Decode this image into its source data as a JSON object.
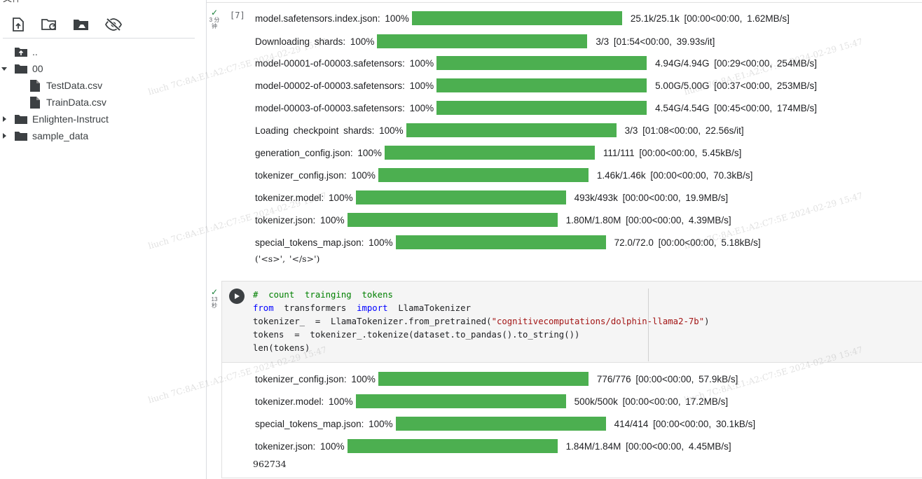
{
  "sidebar": {
    "title": "文件",
    "tree": [
      {
        "label": "..",
        "type": "up"
      },
      {
        "label": "00",
        "type": "folder-open"
      },
      {
        "label": "TestData.csv",
        "type": "file"
      },
      {
        "label": "TrainData.csv",
        "type": "file"
      },
      {
        "label": "Enlighten-Instruct",
        "type": "folder"
      },
      {
        "label": "sample_data",
        "type": "folder"
      }
    ]
  },
  "cell1": {
    "exec_count": "[7]",
    "status": "✓",
    "duration": "3 分\n钟",
    "progress": [
      {
        "desc": "model.safetensors.index.json: 100%",
        "stats": "25.1k/25.1k  [00:00<00:00,  1.62MB/s]",
        "pct": 100
      },
      {
        "desc": "Downloading  shards: 100%",
        "stats": "3/3  [01:54<00:00,  39.93s/it]",
        "pct": 100
      },
      {
        "desc": "model-00001-of-00003.safetensors: 100%",
        "stats": "4.94G/4.94G  [00:29<00:00,  254MB/s]",
        "pct": 100
      },
      {
        "desc": "model-00002-of-00003.safetensors: 100%",
        "stats": "5.00G/5.00G  [00:37<00:00,  253MB/s]",
        "pct": 100
      },
      {
        "desc": "model-00003-of-00003.safetensors: 100%",
        "stats": "4.54G/4.54G  [00:45<00:00,  174MB/s]",
        "pct": 100
      },
      {
        "desc": "Loading  checkpoint  shards: 100%",
        "stats": "3/3  [01:08<00:00,  22.56s/it]",
        "pct": 100
      },
      {
        "desc": "generation_config.json: 100%",
        "stats": "111/111  [00:00<00:00,  5.45kB/s]",
        "pct": 100
      },
      {
        "desc": "tokenizer_config.json: 100%",
        "stats": "1.46k/1.46k  [00:00<00:00,  70.3kB/s]",
        "pct": 100
      },
      {
        "desc": "tokenizer.model: 100%",
        "stats": "493k/493k  [00:00<00:00,  19.9MB/s]",
        "pct": 100
      },
      {
        "desc": "tokenizer.json: 100%",
        "stats": "1.80M/1.80M  [00:00<00:00,  4.39MB/s]",
        "pct": 100
      },
      {
        "desc": "special_tokens_map.json: 100%",
        "stats": "72.0/72.0  [00:00<00:00,  5.18kB/s]",
        "pct": 100
      }
    ],
    "text_output": "('<s>', '</s>')"
  },
  "cell2": {
    "status": "✓",
    "duration": "13\n秒",
    "code": {
      "line1_comment": "#  count  trainging  tokens",
      "line2_from": "from",
      "line2_mod": "  transformers  ",
      "line2_import": "import",
      "line2_name": "  LlamaTokenizer",
      "line3_pre": "tokenizer_  =  LlamaTokenizer.from_pretrained(",
      "line3_str": "\"cognitivecomputations/dolphin-llama2-7b\"",
      "line3_post": ")",
      "line4": "tokens  =  tokenizer_.tokenize(dataset.to_pandas().to_string())",
      "line5": "len(tokens)"
    },
    "progress": [
      {
        "desc": "tokenizer_config.json: 100%",
        "stats": "776/776  [00:00<00:00,  57.9kB/s]",
        "pct": 100
      },
      {
        "desc": "tokenizer.model: 100%",
        "stats": "500k/500k  [00:00<00:00,  17.2MB/s]",
        "pct": 100
      },
      {
        "desc": "special_tokens_map.json: 100%",
        "stats": "414/414  [00:00<00:00,  30.1kB/s]",
        "pct": 100
      },
      {
        "desc": "tokenizer.json: 100%",
        "stats": "1.84M/1.84M  [00:00<00:00,  4.45MB/s]",
        "pct": 100
      }
    ],
    "result": "962734"
  },
  "watermark": "liuch 7C:8A:E1:A2:C7:5E 2024-02-29 15:47",
  "colors": {
    "progress_fill": "#4caf50",
    "keyword": "#0000ff",
    "comment": "#008000",
    "string": "#a31515",
    "status_ok": "#188038"
  }
}
